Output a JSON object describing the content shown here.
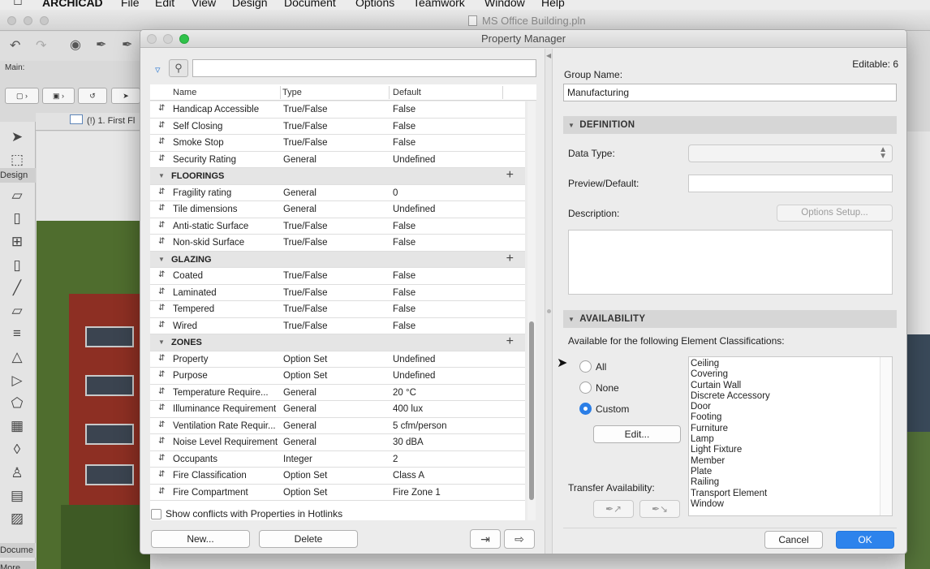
{
  "menubar": {
    "app": "ARCHICAD",
    "items": [
      "File",
      "Edit",
      "View",
      "Design",
      "Document",
      "Options",
      "Teamwork",
      "Window",
      "Help"
    ]
  },
  "host": {
    "title": "MS Office Building.pln",
    "main_label": "Main:",
    "tab_label": "(!) 1. First Fl",
    "toolbox_design": "Design",
    "toolbox_document": "Docume",
    "toolbox_more": "More"
  },
  "dialog": {
    "title": "Property Manager",
    "search_placeholder": "",
    "columns": [
      "Name",
      "Type",
      "Default"
    ],
    "rows": [
      {
        "kind": "prop",
        "name": "Handicap Accessible",
        "type": "True/False",
        "default": "False"
      },
      {
        "kind": "prop",
        "name": "Self Closing",
        "type": "True/False",
        "default": "False"
      },
      {
        "kind": "prop",
        "name": "Smoke Stop",
        "type": "True/False",
        "default": "False"
      },
      {
        "kind": "prop",
        "name": "Security Rating",
        "type": "General",
        "default": "Undefined"
      },
      {
        "kind": "group",
        "name": "FLOORINGS"
      },
      {
        "kind": "prop",
        "name": "Fragility rating",
        "type": "General",
        "default": "0"
      },
      {
        "kind": "prop",
        "name": "Tile dimensions",
        "type": "General",
        "default": "Undefined"
      },
      {
        "kind": "prop",
        "name": "Anti-static Surface",
        "type": "True/False",
        "default": "False"
      },
      {
        "kind": "prop",
        "name": "Non-skid Surface",
        "type": "True/False",
        "default": "False"
      },
      {
        "kind": "group",
        "name": "GLAZING"
      },
      {
        "kind": "prop",
        "name": "Coated",
        "type": "True/False",
        "default": "False"
      },
      {
        "kind": "prop",
        "name": "Laminated",
        "type": "True/False",
        "default": "False"
      },
      {
        "kind": "prop",
        "name": "Tempered",
        "type": "True/False",
        "default": "False"
      },
      {
        "kind": "prop",
        "name": "Wired",
        "type": "True/False",
        "default": "False"
      },
      {
        "kind": "group",
        "name": "ZONES"
      },
      {
        "kind": "prop",
        "name": "Property",
        "type": "Option Set",
        "default": "Undefined"
      },
      {
        "kind": "prop",
        "name": "Purpose",
        "type": "Option Set",
        "default": "Undefined"
      },
      {
        "kind": "prop",
        "name": "Temperature Require...",
        "type": "General",
        "default": "20 °C"
      },
      {
        "kind": "prop",
        "name": "Illuminance Requirement",
        "type": "General",
        "default": "400 lux"
      },
      {
        "kind": "prop",
        "name": "Ventilation Rate Requir...",
        "type": "General",
        "default": "5 cfm/person"
      },
      {
        "kind": "prop",
        "name": "Noise Level Requirement",
        "type": "General",
        "default": "30 dBA"
      },
      {
        "kind": "prop",
        "name": "Occupants",
        "type": "Integer",
        "default": "2"
      },
      {
        "kind": "prop",
        "name": "Fire Classification",
        "type": "Option Set",
        "default": "Class A"
      },
      {
        "kind": "prop",
        "name": "Fire Compartment",
        "type": "Option Set",
        "default": "Fire Zone 1"
      }
    ],
    "show_conflicts_label": "Show conflicts with Properties in Hotlinks",
    "new_label": "New...",
    "delete_label": "Delete",
    "editable": "Editable: 6",
    "group_name_label": "Group Name:",
    "group_name_value": "Manufacturing",
    "definition_header": "DEFINITION",
    "data_type_label": "Data Type:",
    "preview_label": "Preview/Default:",
    "description_label": "Description:",
    "options_setup_label": "Options Setup...",
    "availability_header": "AVAILABILITY",
    "availability_text": "Available for the following Element Classifications:",
    "radio_all": "All",
    "radio_none": "None",
    "radio_custom": "Custom",
    "edit_label": "Edit...",
    "classifications": [
      "Ceiling",
      "Covering",
      "Curtain Wall",
      "Discrete Accessory",
      "Door",
      "Footing",
      "Furniture",
      "Lamp",
      "Light Fixture",
      "Member",
      "Plate",
      "Railing",
      "Transport Element",
      "Window"
    ],
    "transfer_label": "Transfer Availability:",
    "cancel_label": "Cancel",
    "ok_label": "OK"
  },
  "colors": {
    "accent": "#2d83ec",
    "wall_red": "#8d2f23",
    "grass": "#4f6d2e"
  }
}
